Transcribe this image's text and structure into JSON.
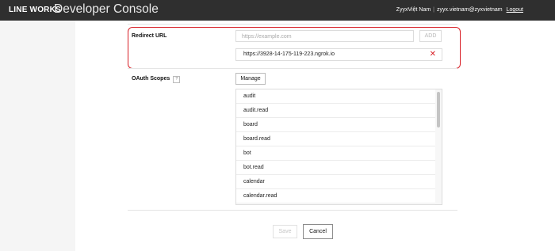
{
  "header": {
    "brand": "LINE WORKS",
    "title": "Developer Console",
    "user_name": "ZyyxViệt Nam",
    "user_email": "zyyx.vietnam@zyxvietnam",
    "logout_label": "Logout"
  },
  "redirect_url": {
    "label": "Redirect URL",
    "input_placeholder": "https://example.com",
    "add_label": "ADD",
    "items": [
      "https://3928-14-175-119-223.ngrok.io"
    ],
    "remove_icon": "close-icon"
  },
  "oauth_scopes": {
    "label": "OAuth Scopes",
    "help_label": "?",
    "manage_label": "Manage",
    "items": [
      "audit",
      "audit.read",
      "board",
      "board.read",
      "bot",
      "bot.read",
      "calendar",
      "calendar.read"
    ]
  },
  "actions": {
    "save_label": "Save",
    "cancel_label": "Cancel"
  },
  "colors": {
    "header_bg": "#2f2f2f",
    "highlight_border": "#d81f26",
    "remove_icon": "#d81f26"
  }
}
